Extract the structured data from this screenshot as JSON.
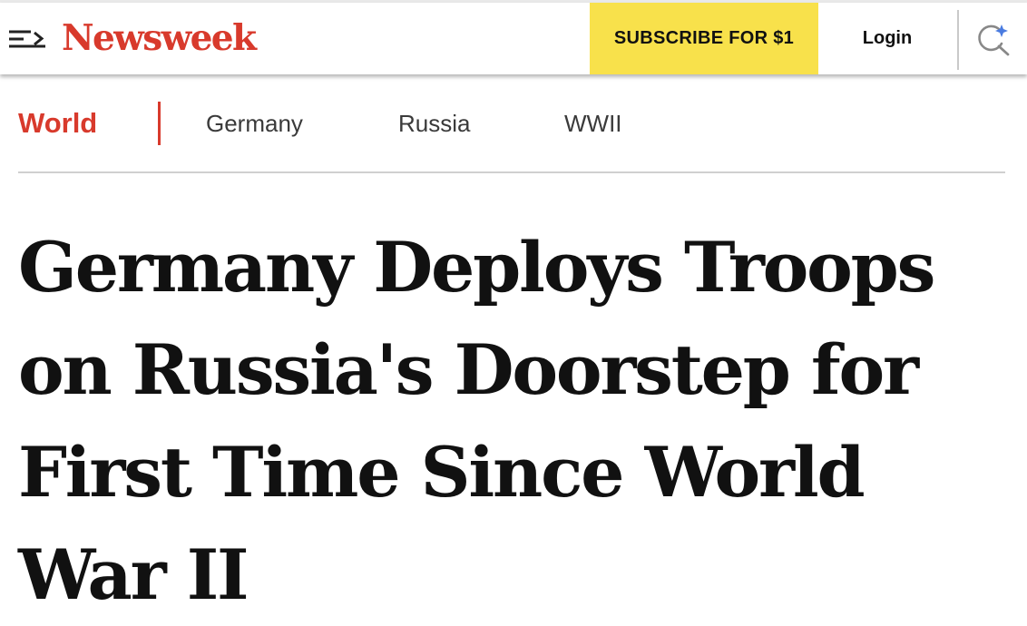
{
  "header": {
    "logo_text": "Newsweek",
    "menu_icon": "menu-arrow-icon",
    "subscribe_label": "SUBSCRIBE FOR $1",
    "login_label": "Login",
    "search_icon": "search-sparkle-icon"
  },
  "nav": {
    "items": [
      {
        "label": "World",
        "active": true
      },
      {
        "label": "Germany",
        "active": false
      },
      {
        "label": "Russia",
        "active": false
      },
      {
        "label": "WWII",
        "active": false
      }
    ]
  },
  "article": {
    "headline": "Germany Deploys Troops on Russia's Doorstep for First Time Since World War II"
  },
  "colors": {
    "brand_red": "#d83a2c",
    "subscribe_yellow": "#f8e14b",
    "text_dark": "#111111"
  }
}
